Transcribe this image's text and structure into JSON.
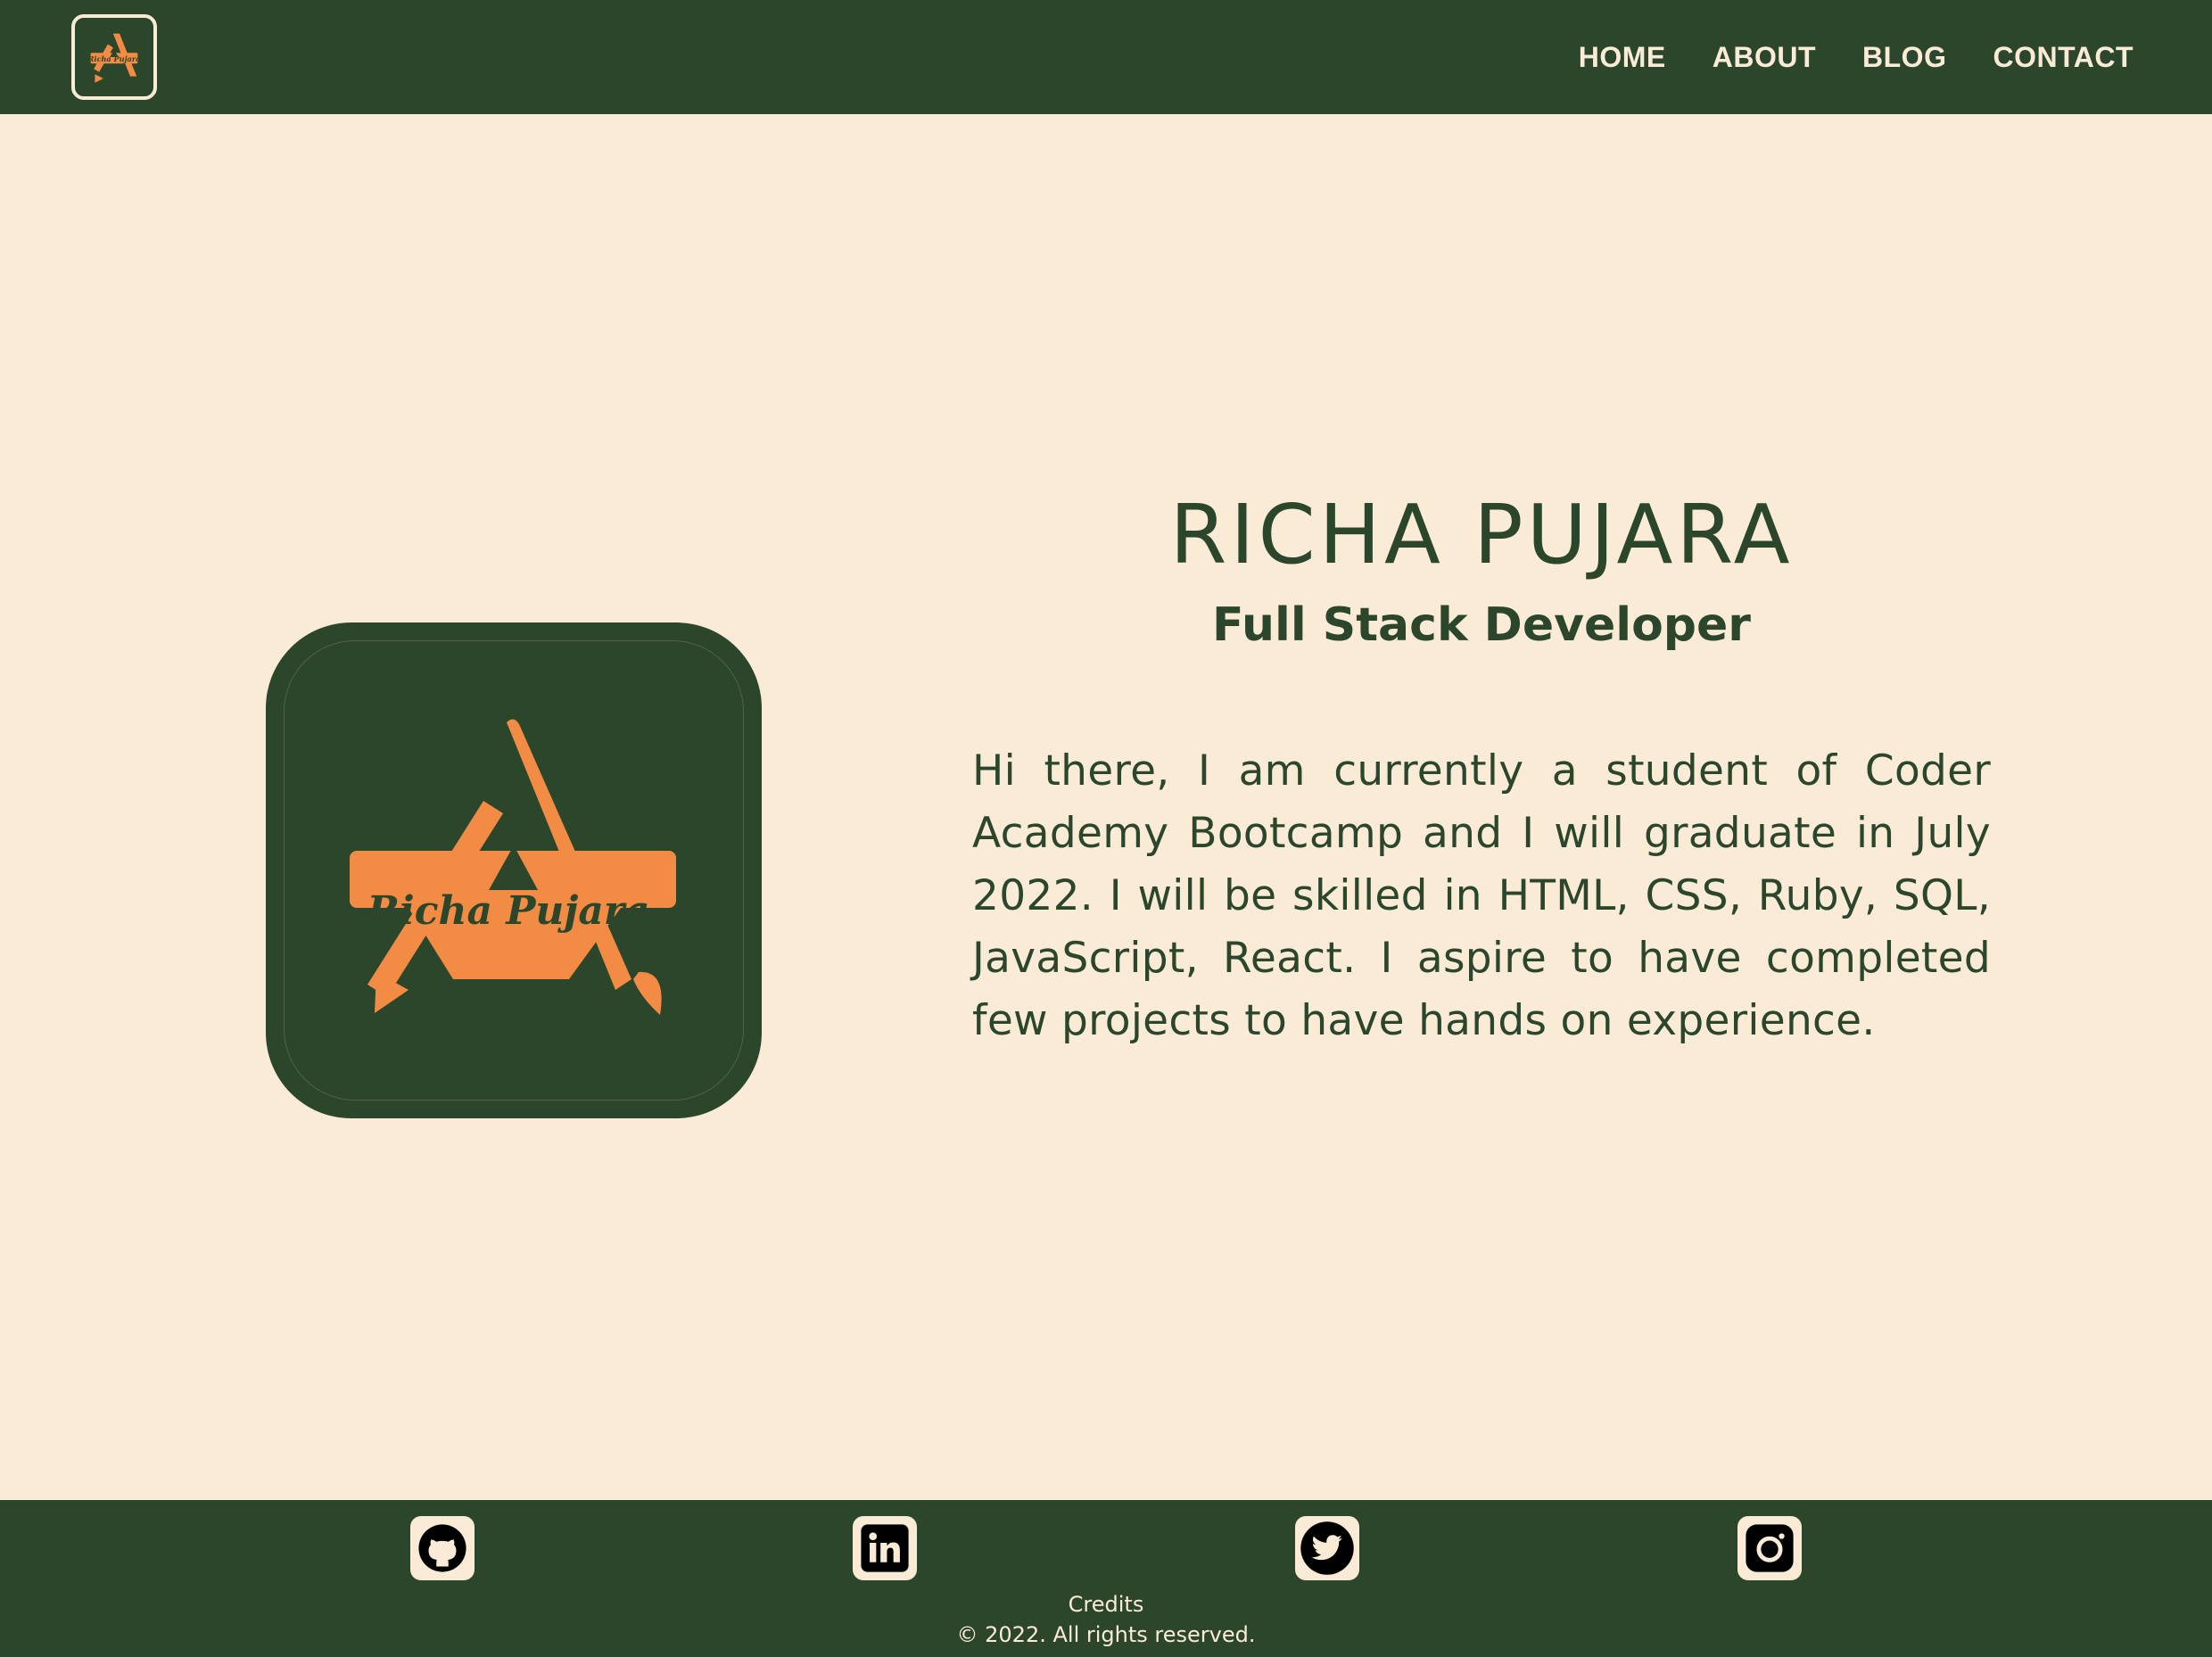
{
  "nav": {
    "logo_text": "Richa Pujara",
    "links": [
      "HOME",
      "ABOUT",
      "BLOG",
      "CONTACT"
    ]
  },
  "hero": {
    "logo_text": "Richa Pujara",
    "name": "RICHA PUJARA",
    "role": "Full Stack Developer",
    "bio": "Hi there, I am currently a student of Coder Academy Bootcamp and I will graduate in July 2022. I will be skilled in HTML, CSS, Ruby, SQL, JavaScript, React. I aspire to have completed few projects to have hands on experience."
  },
  "footer": {
    "socials": [
      "github-icon",
      "linkedin-icon",
      "twitter-icon",
      "instagram-icon"
    ],
    "credits": "Credits",
    "copyright": "© 2022. All rights reserved."
  },
  "colors": {
    "primary": "#2c462b",
    "background": "#faebd7",
    "accent": "#f28c45"
  }
}
